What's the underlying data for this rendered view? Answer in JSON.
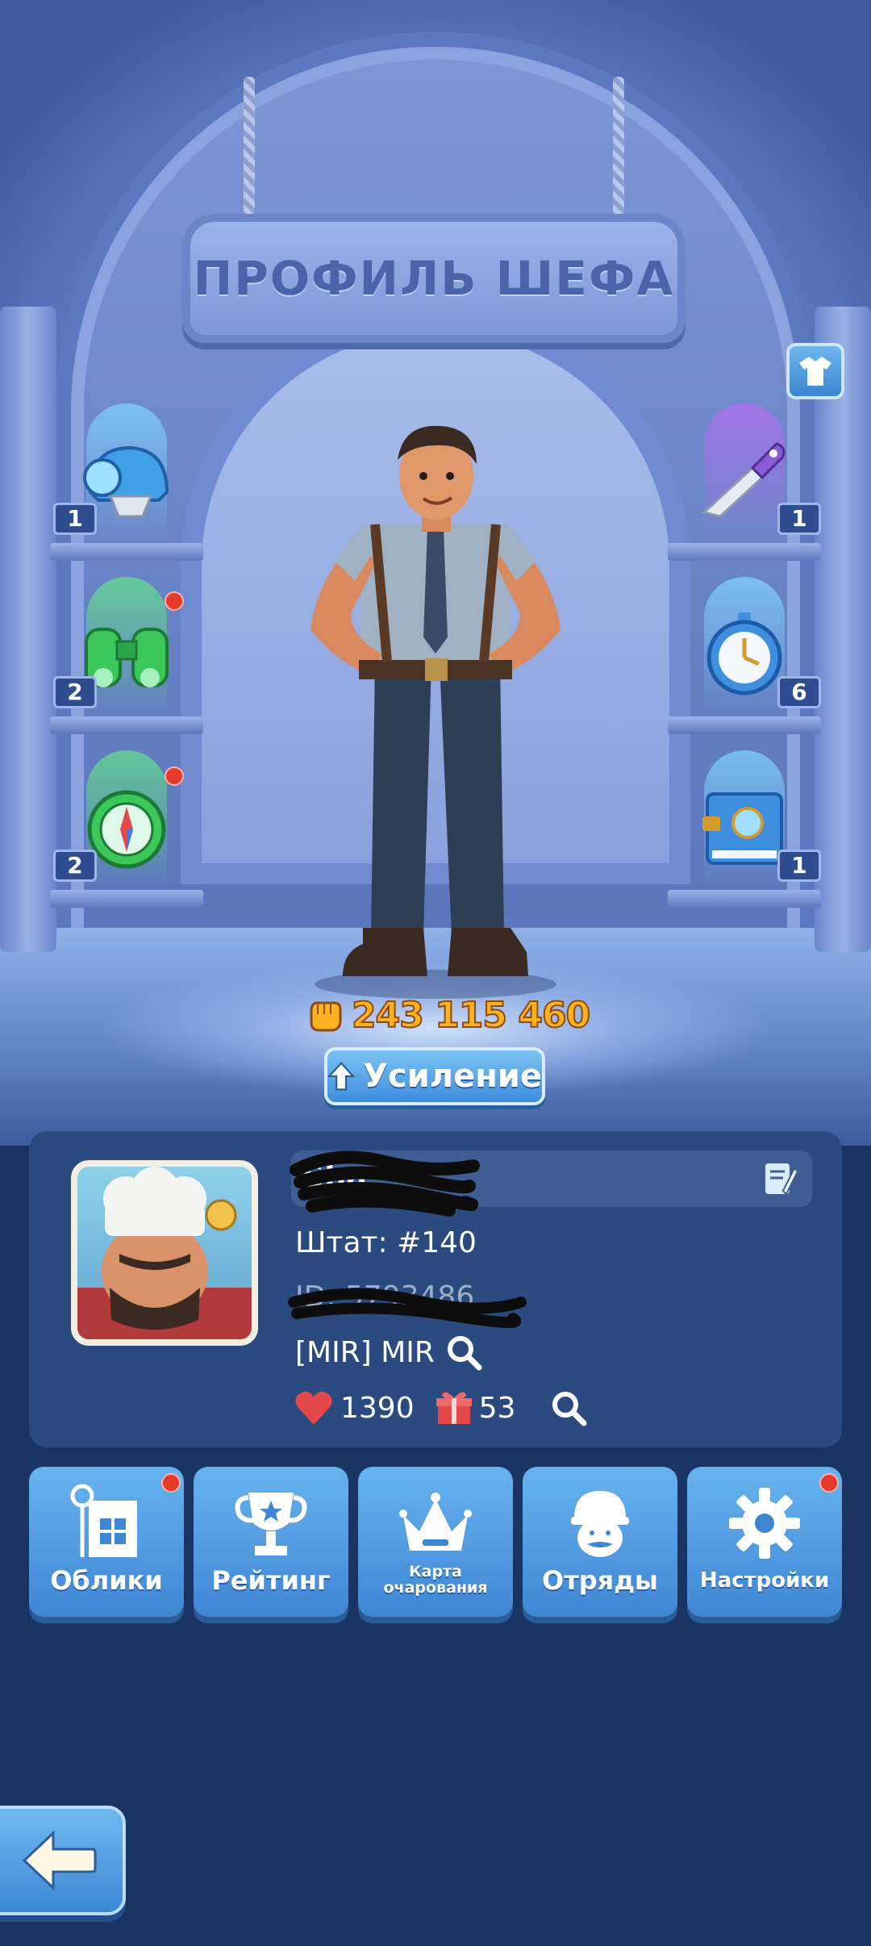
{
  "header": {
    "title": "ПРОФИЛЬ ШЕФА"
  },
  "equipment": {
    "left": [
      {
        "name": "helmet",
        "count": "1",
        "light": "#7fd3ff",
        "notify": false
      },
      {
        "name": "binoculars",
        "count": "2",
        "light": "#63e08b",
        "notify": true
      },
      {
        "name": "compass",
        "count": "2",
        "light": "#63e08b",
        "notify": true
      }
    ],
    "right": [
      {
        "name": "knife",
        "count": "1",
        "light": "#b36cf0"
      },
      {
        "name": "stopwatch",
        "count": "6",
        "light": "#7fd3ff"
      },
      {
        "name": "book",
        "count": "1",
        "light": "#7fd3ff"
      }
    ]
  },
  "power": {
    "value": "243 115 460",
    "icon": "fist-icon"
  },
  "boost": {
    "label": "Усиление"
  },
  "profile": {
    "name": "Sha",
    "state": "Штат: #140",
    "id": "ID: 5793486",
    "alliance": "[MIR] MIR",
    "likes": "1390",
    "gifts": "53"
  },
  "actions": [
    {
      "label": "Облики",
      "icon": "skins-icon",
      "notify": true
    },
    {
      "label": "Рейтинг",
      "icon": "trophy-icon",
      "notify": false
    },
    {
      "label": "Карта\nочарования",
      "icon": "crown-icon",
      "notify": false
    },
    {
      "label": "Отряды",
      "icon": "squad-icon",
      "notify": false
    },
    {
      "label": "Настройки",
      "icon": "gear-icon",
      "notify": true
    }
  ],
  "colors": {
    "accent": "#3f86d4",
    "power": "#ffb21f",
    "notify": "#e53b2c",
    "panel": "#2a4a80"
  }
}
